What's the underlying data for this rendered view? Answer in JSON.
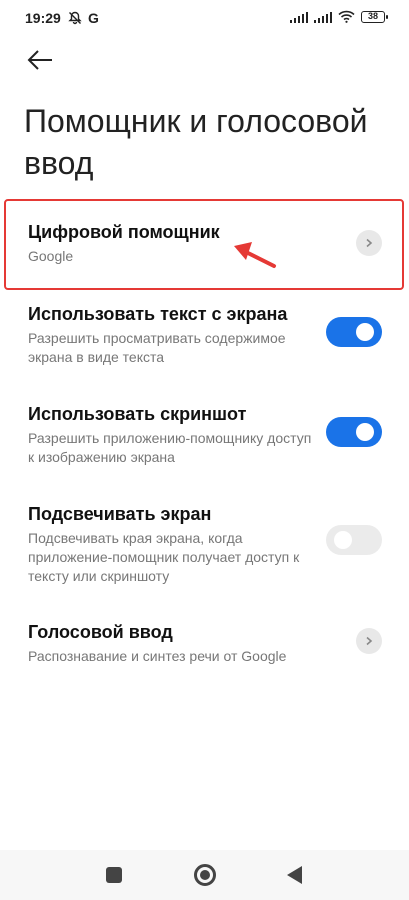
{
  "status_bar": {
    "time": "19:29",
    "g_label": "G",
    "battery": "38"
  },
  "page": {
    "title": "Помощник и голосовой ввод"
  },
  "items": [
    {
      "title": "Цифровой помощник",
      "subtitle": "Google",
      "control": "chevron"
    },
    {
      "title": "Использовать текст с экрана",
      "subtitle": "Разрешить просматривать содержимое экрана в виде текста",
      "control": "toggle",
      "state": "on"
    },
    {
      "title": "Использовать скриншот",
      "subtitle": "Разрешить приложению-помощнику доступ к изображению экрана",
      "control": "toggle",
      "state": "on"
    },
    {
      "title": "Подсвечивать экран",
      "subtitle": "Подсвечивать края экрана, когда приложение-помощник получает доступ к тексту или скриншоту",
      "control": "toggle",
      "state": "off"
    },
    {
      "title": "Голосовой ввод",
      "subtitle": "Распознавание и синтез речи от Google",
      "control": "chevron"
    }
  ],
  "colors": {
    "accent": "#1a73e8",
    "highlight": "#e53935"
  }
}
